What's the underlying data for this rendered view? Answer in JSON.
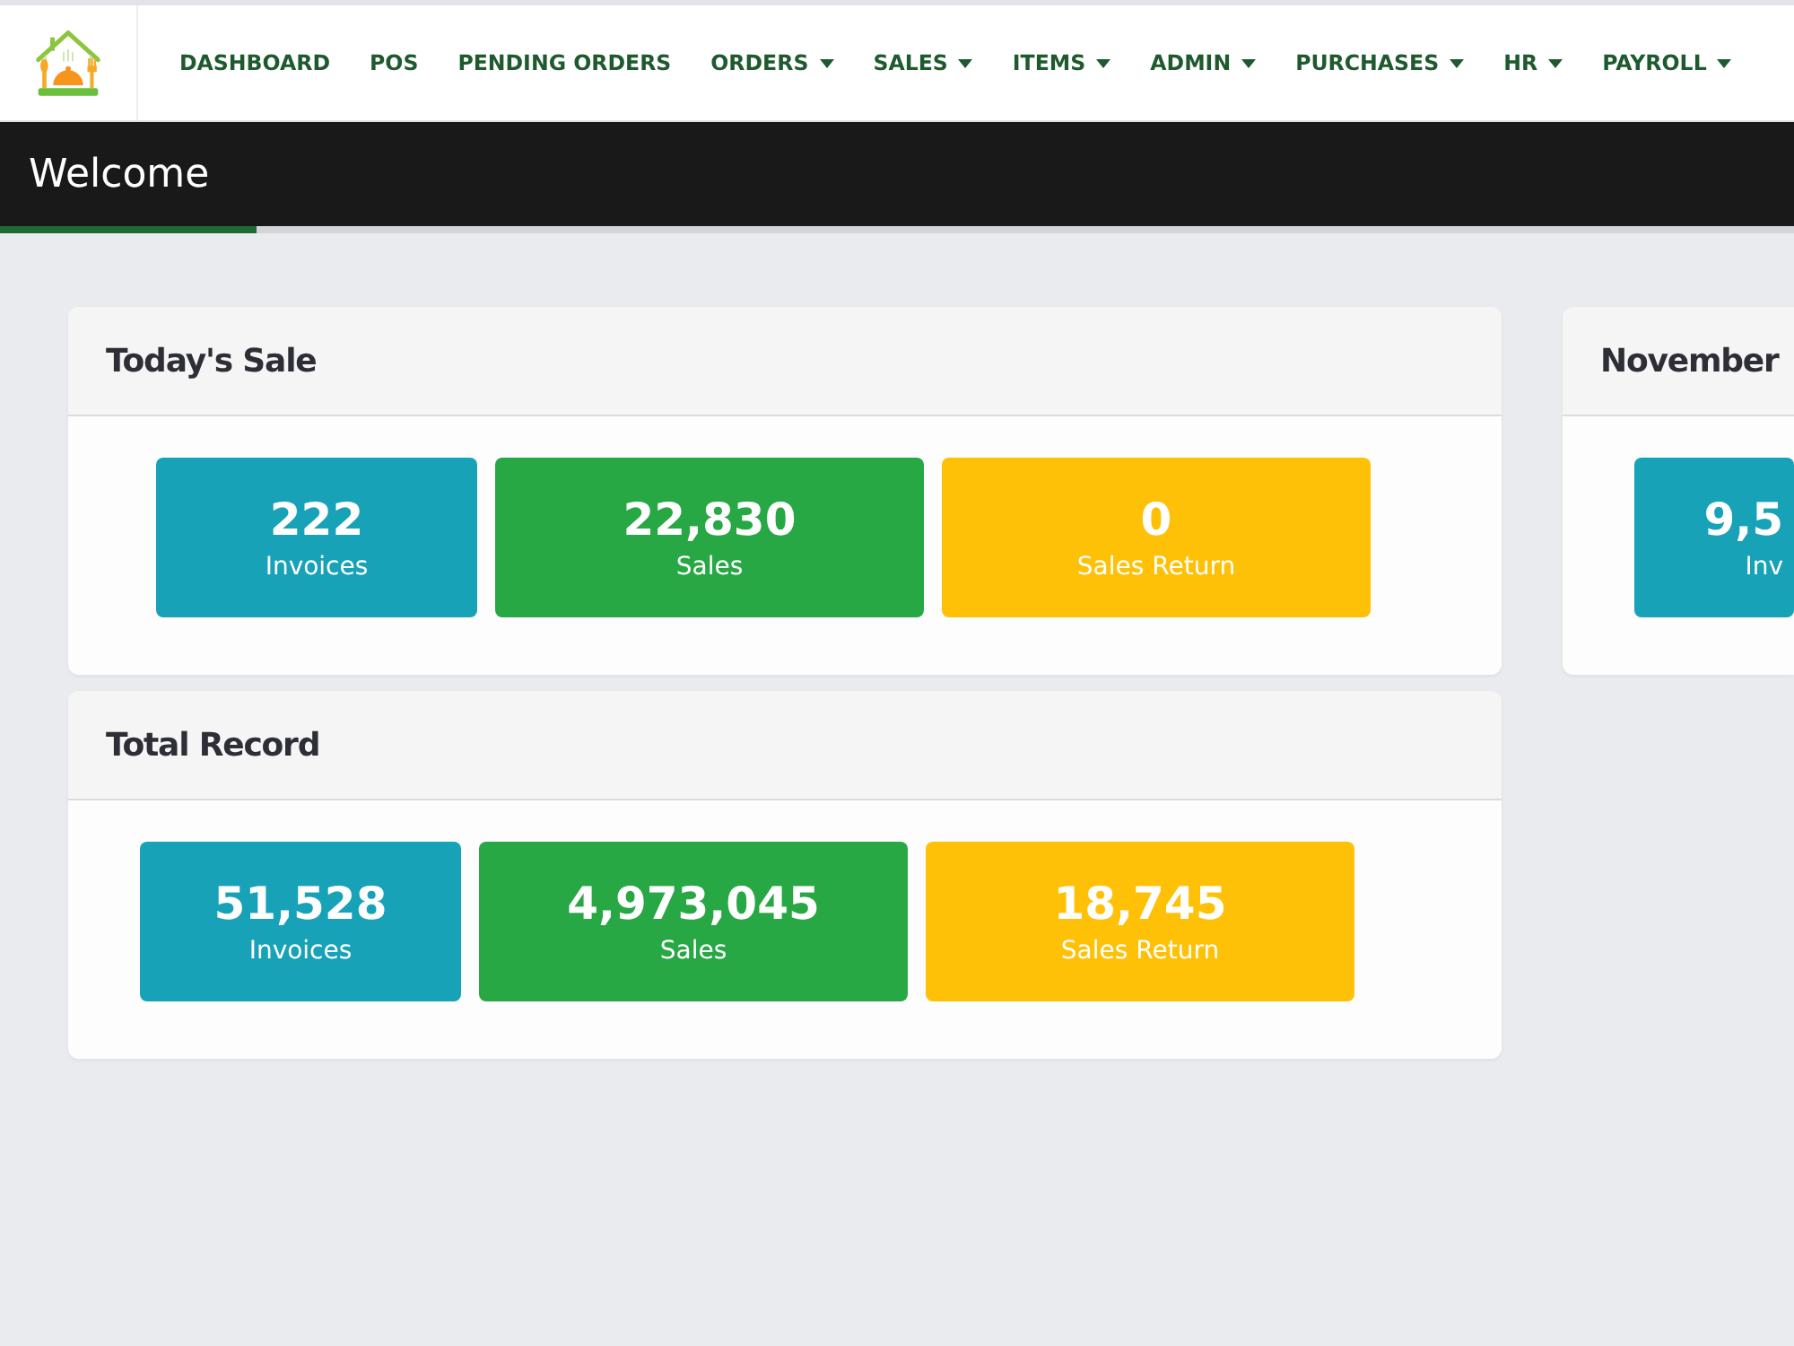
{
  "nav": [
    {
      "label": "DASHBOARD",
      "dropdown": false
    },
    {
      "label": "POS",
      "dropdown": false
    },
    {
      "label": "PENDING ORDERS",
      "dropdown": false
    },
    {
      "label": "ORDERS",
      "dropdown": true
    },
    {
      "label": "SALES",
      "dropdown": true
    },
    {
      "label": "ITEMS",
      "dropdown": true
    },
    {
      "label": "ADMIN",
      "dropdown": true
    },
    {
      "label": "PURCHASES",
      "dropdown": true
    },
    {
      "label": "HR",
      "dropdown": true
    },
    {
      "label": "PAYROLL",
      "dropdown": true
    }
  ],
  "page_header": {
    "title": "Welcome"
  },
  "columns": [
    {
      "cards": [
        {
          "title": "Today's Sale",
          "tiles": [
            {
              "value": "222",
              "label": "Invoices",
              "color": "#17a2b8"
            },
            {
              "value": "22,830",
              "label": "Sales",
              "color": "#28a745"
            },
            {
              "value": "0",
              "label": "Sales Return",
              "color": "#ffc107"
            }
          ]
        },
        {
          "title": "Total Record",
          "tiles": [
            {
              "value": "51,528",
              "label": "Invoices",
              "color": "#17a2b8"
            },
            {
              "value": "4,973,045",
              "label": "Sales",
              "color": "#28a745"
            },
            {
              "value": "18,745",
              "label": "Sales Return",
              "color": "#ffc107"
            }
          ]
        }
      ]
    },
    {
      "cards": [
        {
          "title": "November",
          "tiles": [
            {
              "value": "9,5",
              "label": "Inv",
              "color": "#17a2b8"
            }
          ]
        }
      ]
    }
  ]
}
